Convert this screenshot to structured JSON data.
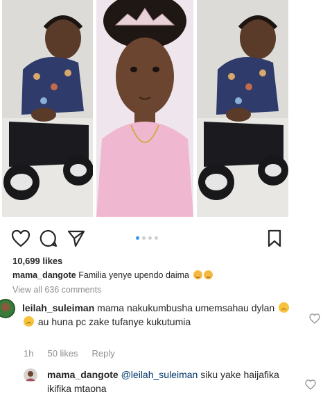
{
  "post": {
    "likes_text": "10,699 likes",
    "caption_user": "mama_dangote",
    "caption_text": "Familia yenye upendo daima",
    "view_all": "View all 636 comments"
  },
  "comments": [
    {
      "user": "leilah_suleiman",
      "text_part1": "mama nakukumbusha umemsahau dylan",
      "text_part2": "au huna pc zake tufanye kukutumia",
      "time": "1h",
      "likes": "50 likes",
      "reply_label": "Reply"
    },
    {
      "user": "mama_dangote",
      "mention": "@leilah_suleiman",
      "text": "siku yake haijafika ikifika mtaona"
    }
  ],
  "carousel": {
    "count": 4,
    "active_index": 0
  },
  "colors": {
    "accent": "#3897f0",
    "muted": "#8e8e8e",
    "text": "#262626"
  },
  "icons": [
    "heart-icon",
    "comment-icon",
    "share-icon",
    "bookmark-icon"
  ]
}
